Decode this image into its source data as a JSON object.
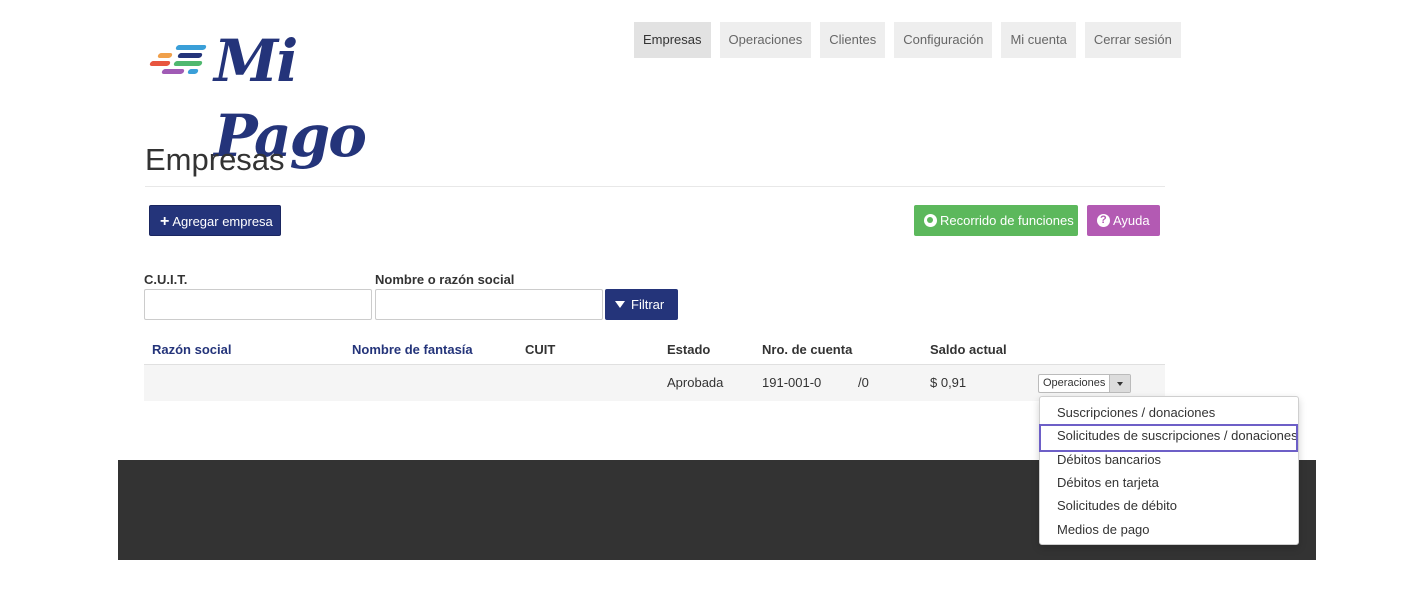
{
  "brand": {
    "name": "Mi Pago",
    "stripe_colors": [
      "#f0a04b",
      "#e8553f",
      "#3a9fd8",
      "#4fb86f",
      "#a05bb5",
      "#24347a"
    ]
  },
  "nav": {
    "items": [
      {
        "label": "Empresas"
      },
      {
        "label": "Operaciones"
      },
      {
        "label": "Clientes"
      },
      {
        "label": "Configuración"
      },
      {
        "label": "Mi cuenta"
      },
      {
        "label": "Cerrar sesión"
      }
    ]
  },
  "page": {
    "title": "Empresas"
  },
  "actions": {
    "add_label": "Agregar empresa",
    "tour_label": "Recorrido de funciones",
    "help_label": "Ayuda"
  },
  "filters": {
    "cuit_label": "C.U.I.T.",
    "cuit_value": "",
    "name_label": "Nombre o razón social",
    "name_value": "",
    "button_label": "Filtrar"
  },
  "table": {
    "headers": {
      "razon": "Razón social",
      "fantasia": "Nombre de fantasía",
      "cuit": "CUIT",
      "estado": "Estado",
      "cuenta": "Nro. de cuenta",
      "saldo": "Saldo actual"
    },
    "rows": [
      {
        "razon": "",
        "fantasia": "",
        "cuit": "",
        "estado": "Aprobada",
        "cuenta": "191-001-0",
        "cuenta_suffix": "/0",
        "saldo": "$ 0,91",
        "ops_label": "Operaciones"
      }
    ]
  },
  "dropdown": {
    "items": [
      {
        "label": "Suscripciones / donaciones"
      },
      {
        "label": "Solicitudes de suscripciones / donaciones"
      },
      {
        "label": "Débitos bancarios"
      },
      {
        "label": "Débitos en tarjeta"
      },
      {
        "label": "Solicitudes de débito"
      },
      {
        "label": "Medios de pago"
      }
    ],
    "highlighted_index": 1,
    "highlight_color": "#6d5fc7"
  },
  "colors": {
    "primary": "#24347a",
    "success": "#5cb85c",
    "help": "#b35ab3",
    "footer": "#333333"
  }
}
